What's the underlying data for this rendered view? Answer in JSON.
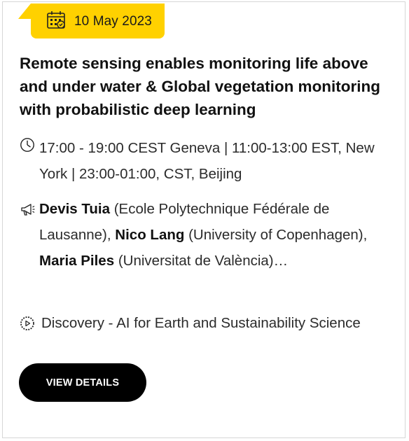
{
  "event": {
    "date": "10 May 2023",
    "title": "Remote sensing enables monitoring life above and under water & Global vegetation monitoring with probabilistic deep learning",
    "time": "17:00 - 19:00 CEST Geneva | 11:00-13:00 EST, New York | 23:00-01:00, CST, Beijing",
    "speakers": [
      {
        "name": "Devis Tuia",
        "affiliation": "(Ecole Polytechnique Fédérale de Lausanne),"
      },
      {
        "name": "Nico Lang",
        "affiliation": "(University of Copenhagen),"
      },
      {
        "name": "Maria Piles",
        "affiliation": "(Universitat de València)…"
      }
    ],
    "track": "Discovery - AI for Earth and Sustainability Science",
    "cta_label": "VIEW DETAILS"
  },
  "icons": {
    "date": "calendar-icon",
    "time": "clock-icon",
    "speakers": "megaphone-icon",
    "track": "play-badge-icon"
  },
  "colors": {
    "badge": "#ffd100",
    "button": "#000000",
    "button_text": "#ffffff"
  }
}
